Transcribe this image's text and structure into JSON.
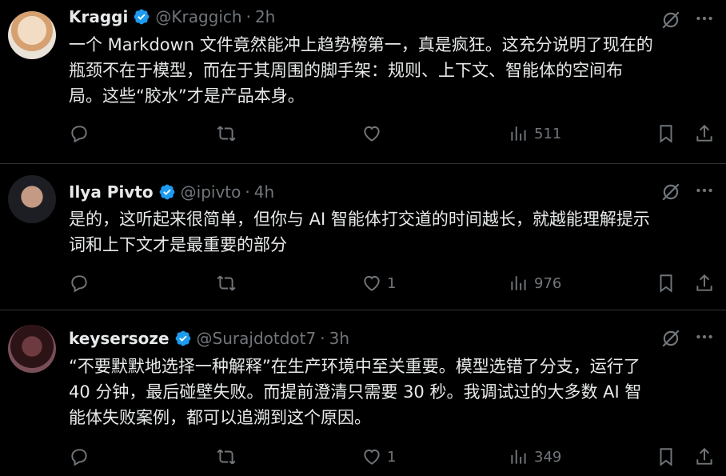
{
  "tweets": [
    {
      "name": "Kraggi",
      "handle": "@Kraggich",
      "time": "2h",
      "text": "一个 Markdown 文件竟然能冲上趋势榜第一，真是疯狂。这充分说明了现在的\n瓶颈不在于模型，而在于其周围的脚手架：规则、上下文、智能体的空间布\n局。这些“胶水”才是产品本身。",
      "likes": "",
      "views": "511"
    },
    {
      "name": "Ilya Pivto",
      "handle": "@ipivto",
      "time": "4h",
      "text": "是的，这听起来很简单，但你与 AI 智能体打交道的时间越长，就越能理解提示\n词和上下文才是最重要的部分",
      "likes": "1",
      "views": "976"
    },
    {
      "name": "keysersoze",
      "handle": "@Surajdotdot7",
      "time": "3h",
      "text": "“不要默默地选择一种解释”在生产环境中至关重要。模型选错了分支，运行了\n40 分钟，最后碰壁失败。而提前澄清只需要 30 秒。我调试过的大多数 AI 智\n能体失败案例，都可以追溯到这个原因。",
      "likes": "1",
      "views": "349"
    }
  ],
  "separator": "·",
  "colors": {
    "background": "#000000",
    "text": "#e7e9ea",
    "muted": "#71767b",
    "verified": "#1d9bf0",
    "divider": "#2f3336"
  },
  "icons": {
    "verified": "verified-badge-icon",
    "grok": "grok-icon",
    "more": "more-icon",
    "reply": "reply-icon",
    "retweet": "retweet-icon",
    "like": "heart-icon",
    "views": "views-icon",
    "bookmark": "bookmark-icon",
    "share": "share-icon"
  }
}
